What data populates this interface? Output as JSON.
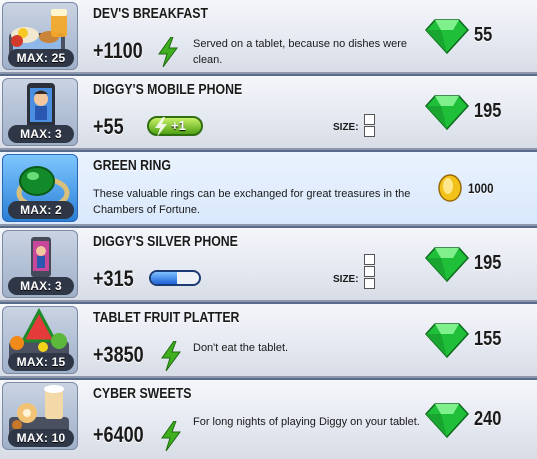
{
  "items": [
    {
      "title": "DEV'S BREAKFAST",
      "max": "MAX: 25",
      "bonus": "+1100",
      "description": "Served on a tablet, because no dishes were clean.",
      "price": "55",
      "currency": "gem-icon"
    },
    {
      "title": "DIGGY'S MOBILE PHONE",
      "max": "MAX: 3",
      "bonus": "+55",
      "energy_bonus": "+1",
      "size_label": "SIZE:",
      "price": "195",
      "currency": "gem-icon"
    },
    {
      "title": "GREEN RING",
      "max": "MAX: 2",
      "description": "These valuable rings can be exchanged for great treasures in the Chambers of Fortune.",
      "price": "1000",
      "currency": "coin-icon"
    },
    {
      "title": "DIGGY'S SILVER PHONE",
      "max": "MAX: 3",
      "bonus": "+315",
      "size_label": "SIZE:",
      "capacity_fill": 0.55,
      "price": "195",
      "currency": "gem-icon"
    },
    {
      "title": "TABLET FRUIT PLATTER",
      "max": "MAX: 15",
      "bonus": "+3850",
      "description": "Don't eat the tablet.",
      "price": "155",
      "currency": "gem-icon"
    },
    {
      "title": "CYBER SWEETS",
      "max": "MAX: 10",
      "bonus": "+6400",
      "description": "For long nights of playing Diggy on your tablet.",
      "price": "240",
      "currency": "gem-icon"
    }
  ],
  "colors": {
    "gem": "#1fbf3a",
    "energy": "#3fae1f",
    "coin": "#f2c21a",
    "ring_highlight": "#2a7fd6"
  }
}
